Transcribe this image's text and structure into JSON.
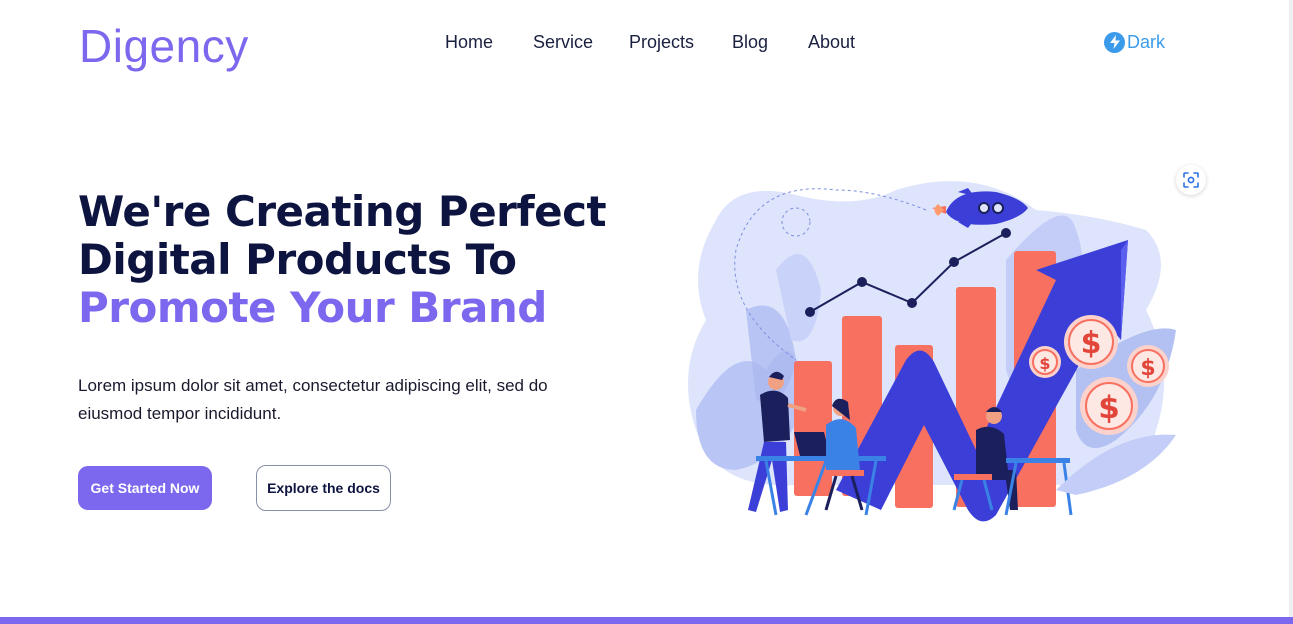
{
  "header": {
    "logo": "Digency",
    "nav": [
      "Home",
      "Service",
      "Projects",
      "Blog",
      "About"
    ],
    "theme_toggle": {
      "label": "Dark",
      "icon": "lightning-bolt-icon"
    }
  },
  "hero": {
    "title_line1": "We're Creating Perfect",
    "title_line2": "Digital Products To",
    "title_accent": "Promote Your Brand",
    "description": "Lorem ipsum dolor sit amet, consectetur adipiscing elit, sed do eiusmod tempor incididunt.",
    "primary_button": "Get Started Now",
    "secondary_button": "Explore the docs"
  },
  "colors": {
    "brand": "#7b68ee",
    "heading": "#0d1440",
    "toggle": "#3b9bea",
    "bars": "#f87060",
    "arrow": "#3b3fd8"
  },
  "icons": {
    "scan": "image-search-icon",
    "illustration": "growth-chart-illustration"
  }
}
